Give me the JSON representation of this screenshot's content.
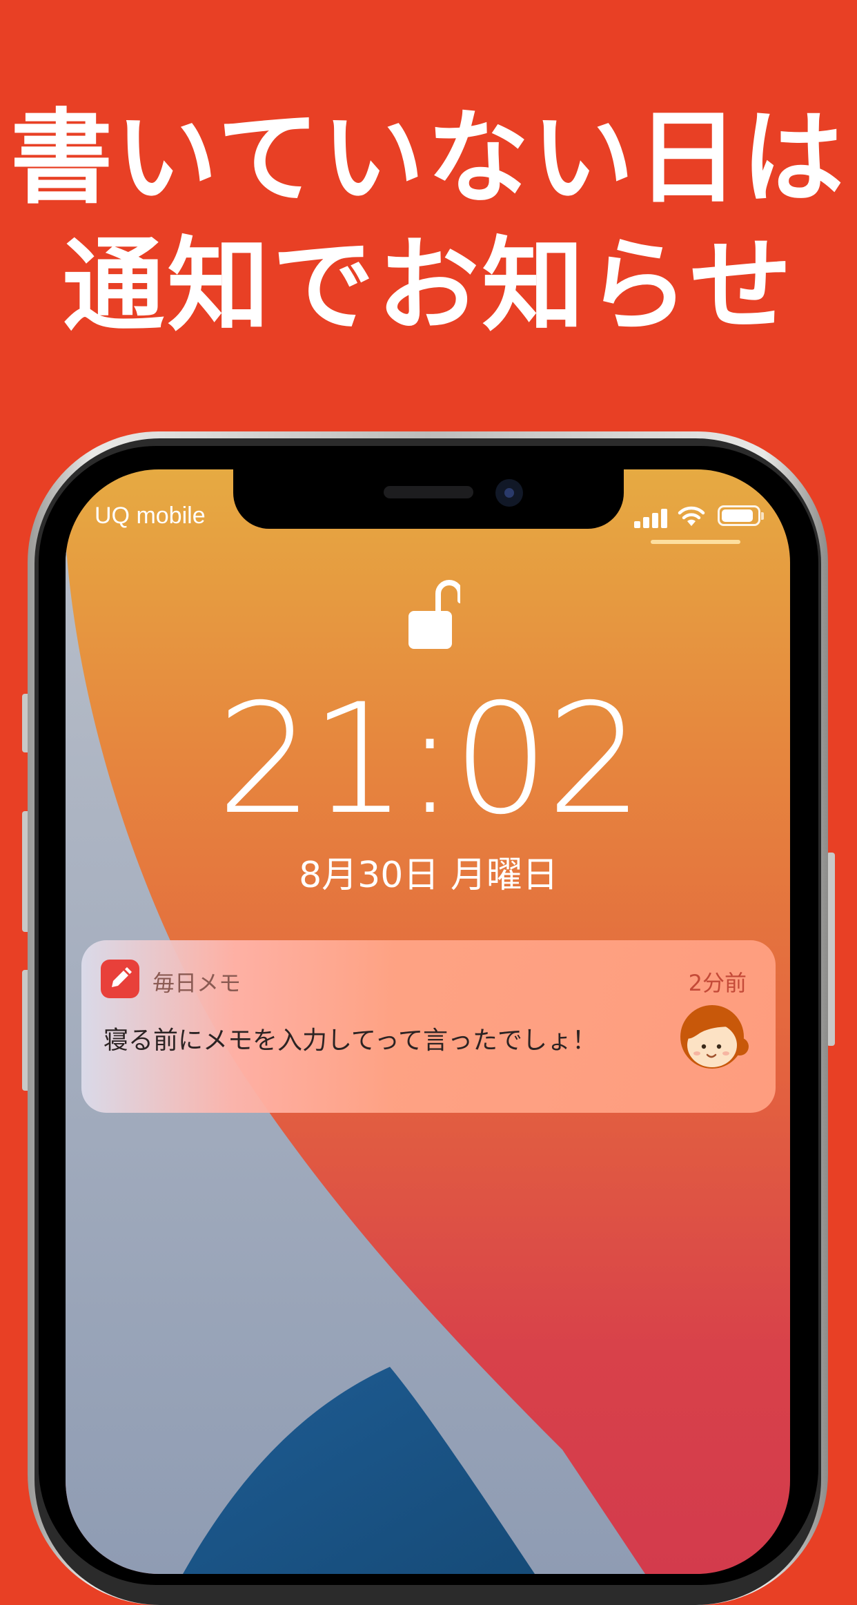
{
  "headline": {
    "line1": "書いていない日は",
    "line2": "通知でお知らせ"
  },
  "status_bar": {
    "carrier": "UQ mobile",
    "signal_icon": "signal-bars-icon",
    "wifi_icon": "wifi-icon",
    "battery_icon": "battery-icon",
    "battery_level": 0.9
  },
  "lock_screen": {
    "lock_icon": "unlocked-padlock-icon",
    "time": "21:02",
    "date": "8月30日 月曜日"
  },
  "notification": {
    "app_icon": "pencil-icon",
    "app_name": "毎日メモ",
    "timestamp": "2分前",
    "message": "寝る前にメモを入力してって言ったでしょ！",
    "avatar": "girl-face-avatar"
  },
  "colors": {
    "background": "#E84025",
    "app_icon": "#E8403A",
    "timestamp": "#C44A38"
  }
}
